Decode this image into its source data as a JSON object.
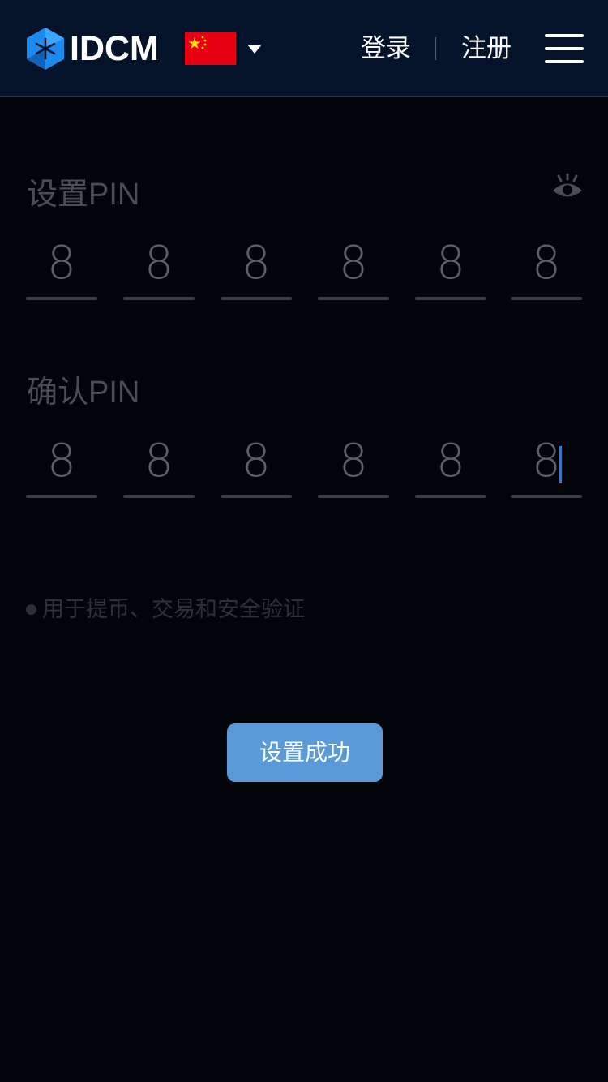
{
  "header": {
    "brand": "IDCM",
    "login": "登录",
    "register": "注册",
    "language_flag": "china-flag-icon",
    "brand_colors": {
      "logo": "#1b8cf0",
      "header_bg": "#04122a"
    }
  },
  "set_pin": {
    "label": "设置PIN",
    "digits": [
      "8",
      "8",
      "8",
      "8",
      "8",
      "8"
    ]
  },
  "confirm_pin": {
    "label": "确认PIN",
    "digits": [
      "8",
      "8",
      "8",
      "8",
      "8",
      "8"
    ]
  },
  "note": "用于提币、交易和安全验证",
  "submit_button": "设置成功",
  "colors": {
    "page_bg": "#010409",
    "button": "#5b9ad8",
    "cursor": "#3a78c2"
  }
}
